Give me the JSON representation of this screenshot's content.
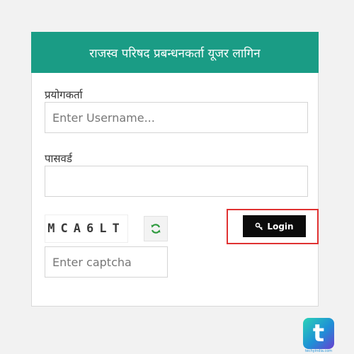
{
  "login_form": {
    "title": "राजस्व परिषद प्रबन्धनकर्ता यूजर लागिन",
    "username_label": "प्रयोगकर्ता",
    "username_placeholder": "Enter Username...",
    "password_label": "पासवर्ड",
    "password_placeholder": "",
    "captcha_text": "MCA6LT",
    "captcha_placeholder": "Enter captcha",
    "login_button_label": "Login"
  },
  "watermark": {
    "logo_letter": "t",
    "caption": "techyindia.com"
  },
  "colors": {
    "header_bg": "#1a9c85",
    "login_button_bg": "#0b0b0b",
    "highlight_border": "#e03232",
    "refresh_icon": "#2e9a3e"
  },
  "icons": {
    "refresh": "refresh-icon",
    "login": "key-icon"
  }
}
